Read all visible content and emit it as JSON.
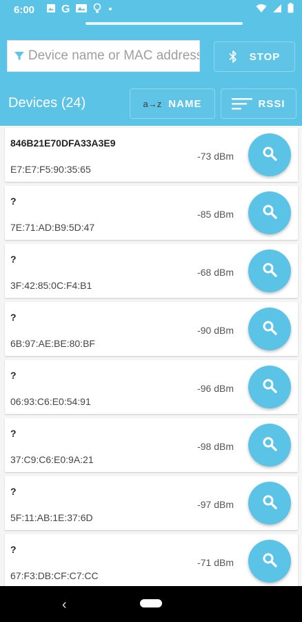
{
  "status_bar": {
    "time": "6:00",
    "left_icons": [
      "image-icon",
      "google-icon",
      "gallery-icon",
      "bulb-icon",
      "dot-icon"
    ],
    "right_icons": [
      "wifi-icon",
      "signal-icon",
      "battery-icon"
    ]
  },
  "toolbar": {
    "filter_placeholder": "Device name or MAC address",
    "stop_label": "STOP",
    "devices_label": "Devices (24)",
    "sort_name_label": "NAME",
    "sort_name_icon_text": "a→z",
    "sort_rssi_label": "RSSI"
  },
  "colors": {
    "primary": "#5bc3e6",
    "card": "#ffffff",
    "background": "#f5f5f5"
  },
  "devices": [
    {
      "name": "846B21E70DFA33A3E9",
      "mac": "E7:E7:F5:90:35:65",
      "rssi": "-73 dBm"
    },
    {
      "name": "?",
      "mac": "7E:71:AD:B9:5D:47",
      "rssi": "-85 dBm"
    },
    {
      "name": "?",
      "mac": "3F:42:85:0C:F4:B1",
      "rssi": "-68 dBm"
    },
    {
      "name": "?",
      "mac": "6B:97:AE:BE:80:BF",
      "rssi": "-90 dBm"
    },
    {
      "name": "?",
      "mac": "06:93:C6:E0:54:91",
      "rssi": "-96 dBm"
    },
    {
      "name": "?",
      "mac": "37:C9:C6:E0:9A:21",
      "rssi": "-98 dBm"
    },
    {
      "name": "?",
      "mac": "5F:11:AB:1E:37:6D",
      "rssi": "-97 dBm"
    },
    {
      "name": "?",
      "mac": "67:F3:DB:CF:C7:CC",
      "rssi": "-71 dBm"
    }
  ],
  "nav_bar": {
    "back_glyph": "‹"
  }
}
